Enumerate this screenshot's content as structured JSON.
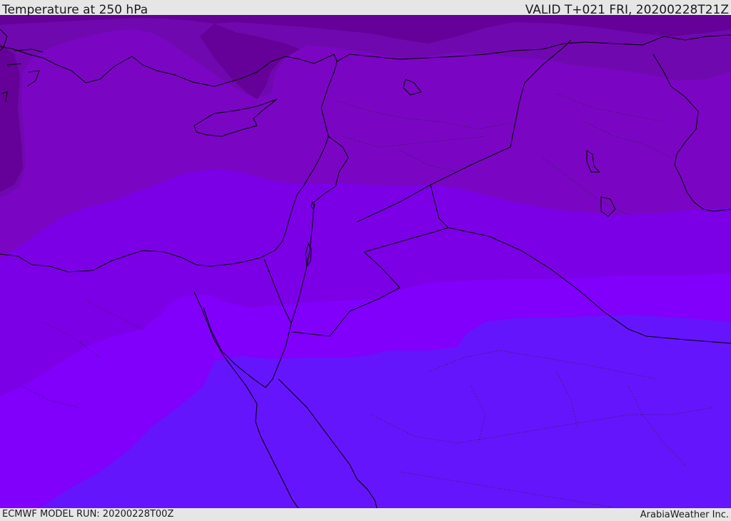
{
  "header": {
    "title": "Temperature at 250 hPa",
    "valid": "VALID T+021 FRI, 20200228T21Z"
  },
  "footer": {
    "model_run": "ECMWF MODEL RUN: 20200228T00Z",
    "credit": "ArabiaWeather Inc."
  },
  "colors": {
    "band_coldest": "#650098",
    "band_cold": "#7008b0",
    "band_mid_cold": "#7a06c4",
    "band_mid": "#7c00e6",
    "band_warm": "#8000fb",
    "band_warmest": "#6515fb",
    "coastline": "#000000"
  }
}
